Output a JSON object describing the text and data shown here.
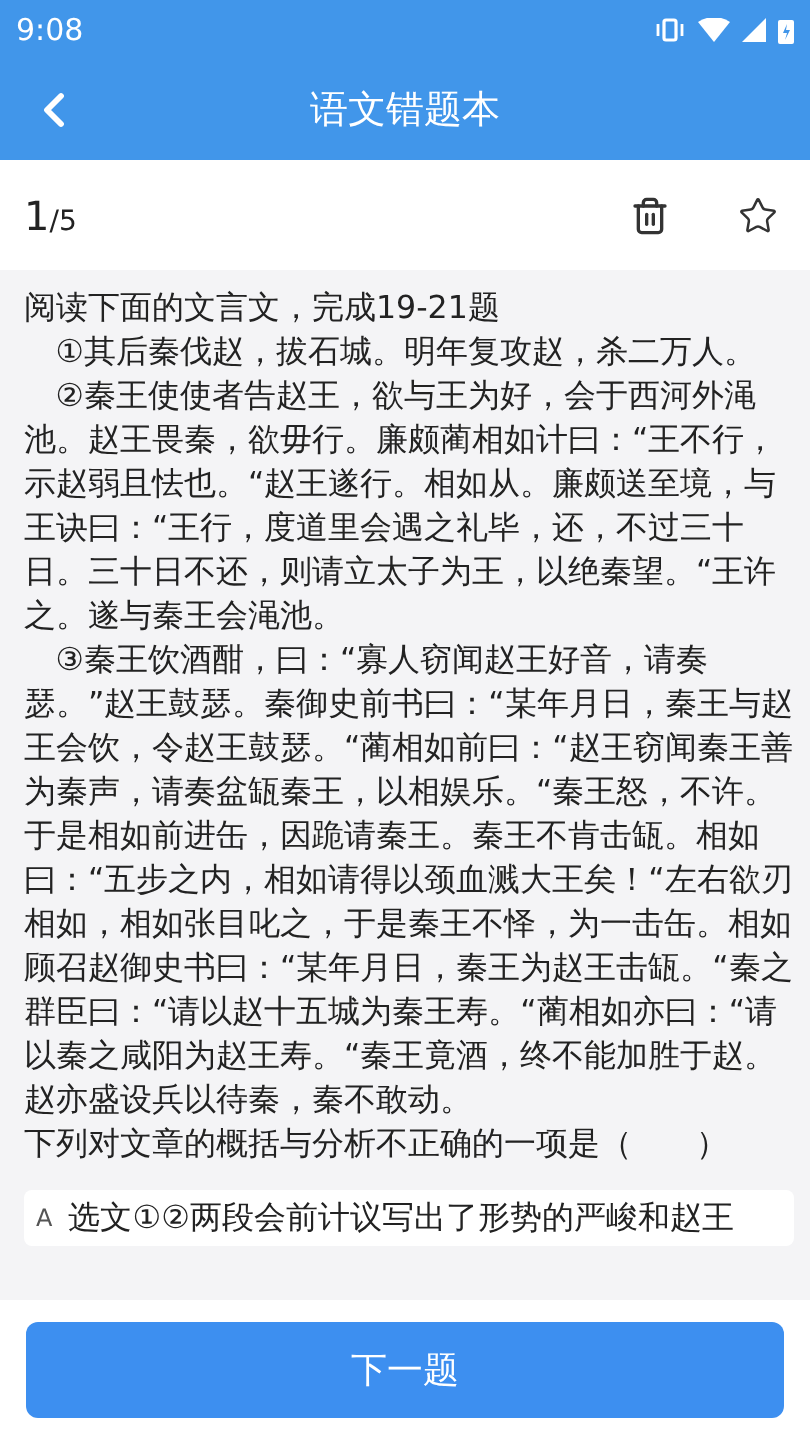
{
  "status_bar": {
    "time": "9:08"
  },
  "header": {
    "title": "语文错题本"
  },
  "counter": {
    "current": "1",
    "total": "/5",
    "favorite": false
  },
  "question": {
    "paragraphs": [
      {
        "kind": "intro",
        "text": "阅读下面的文言文，完成19-21题"
      },
      {
        "kind": "passage",
        "text": "①其后秦伐赵，拔石城。明年复攻赵，杀二万人。"
      },
      {
        "kind": "passage",
        "text": "②秦王使使者告赵王，欲与王为好，会于西河外渑池。赵王畏秦，欲毋行。廉颇蔺相如计曰：“王不行，示赵弱且怯也。“赵王遂行。相如从。廉颇送至境，与王诀曰：“王行，度道里会遇之礼毕，还，不过三十日。三十日不还，则请立太子为王，以绝秦望。“王许之。遂与秦王会渑池。"
      },
      {
        "kind": "passage",
        "text": "③秦王饮酒酣，曰：“寡人窃闻赵王好音，请奏瑟。”赵王鼓瑟。秦御史前书曰：“某年月日，秦王与赵王会饮，令赵王鼓瑟。“蔺相如前曰：“赵王窃闻秦王善为秦声，请奏盆缻秦王，以相娱乐。“秦王怒，不许。于是相如前进缶，因跪请秦王。秦王不肯击缻。相如曰：“五步之内，相如请得以颈血溅大王矣！“左右欲刃相如，相如张目叱之，于是秦王不怿，为一击缶。相如顾召赵御史书曰：“某年月日，秦王为赵王击缻。“秦之群臣曰：“请以赵十五城为秦王寿。“蔺相如亦曰：“请以秦之咸阳为赵王寿。“秦王竟酒，终不能加胜于赵。赵亦盛设兵以待秦，秦不敢动。"
      },
      {
        "kind": "question",
        "text": "下列对文章的概括与分析不正确的一项是（　　）"
      }
    ],
    "options": [
      {
        "label": "A",
        "text": "选文①②两段会前计议写出了形势的严峻和赵王",
        "selected": false
      }
    ]
  },
  "footer": {
    "button": "下一题"
  }
}
